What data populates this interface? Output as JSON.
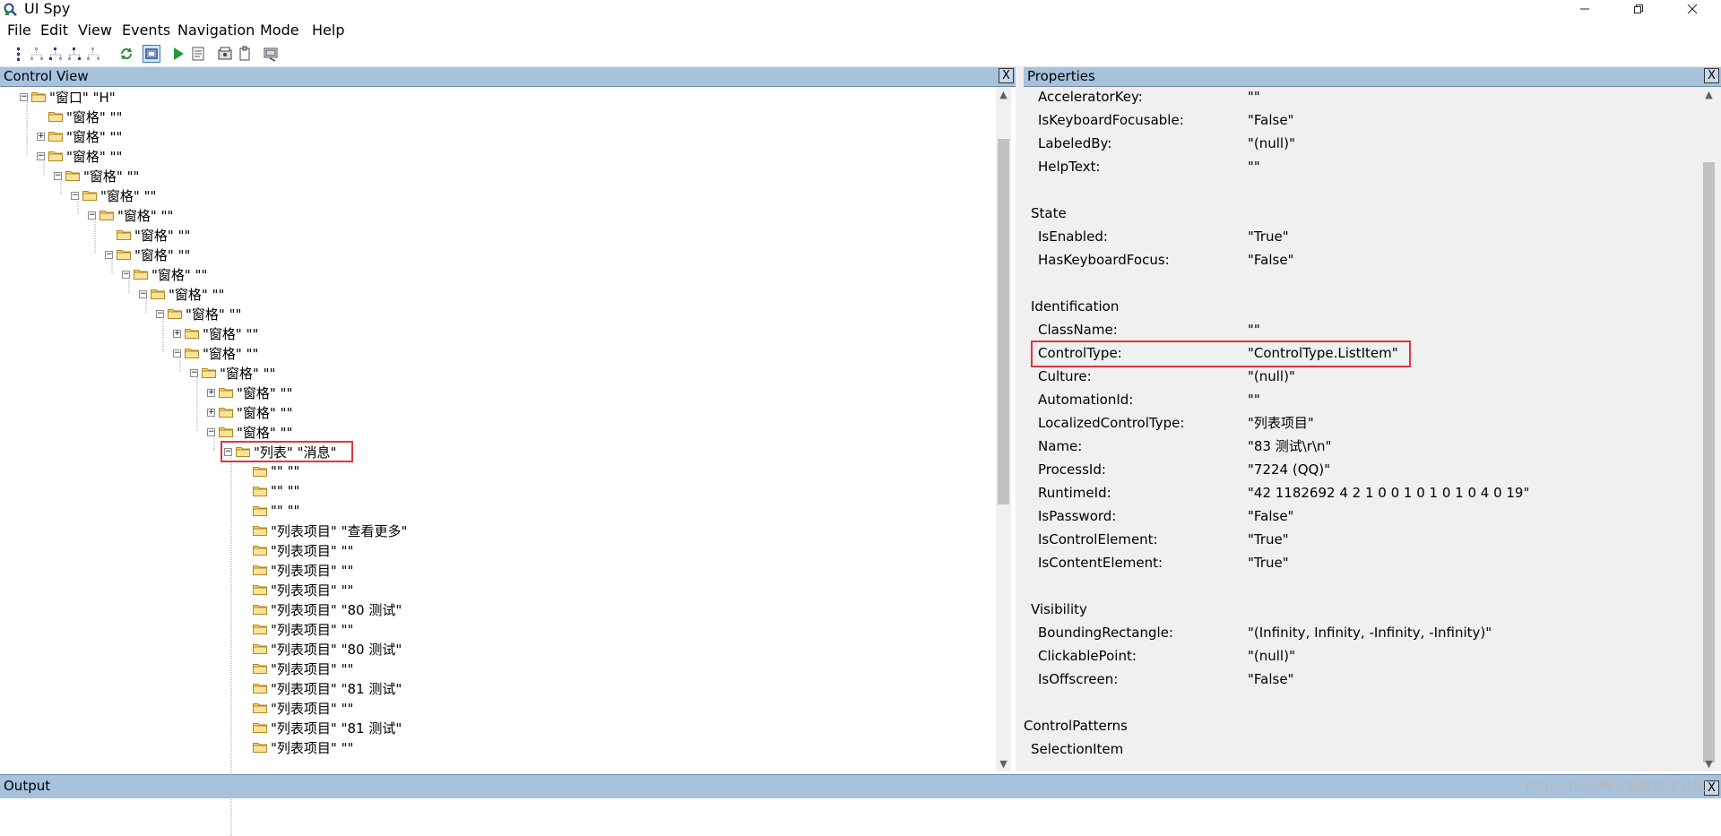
{
  "window": {
    "title": "UI Spy"
  },
  "menu": [
    "File",
    "Edit",
    "View",
    "Events",
    "Navigation",
    "Mode",
    "Help"
  ],
  "toolbar": {
    "icons": [
      "tree-nav-icon",
      "tree-parent-icon",
      "tree-first-child-icon",
      "tree-next-sibling-icon",
      "tree-last-child-icon",
      "refresh-icon",
      "focus-tracking-icon",
      "play-icon",
      "report-icon",
      "record-icon",
      "clipboard-icon",
      "highlight-icon"
    ]
  },
  "control_view": {
    "title": "Control View",
    "close": "X",
    "nodes": [
      {
        "label": "\"窗口\" \"H\"",
        "state": "minus"
      },
      {
        "label": "\"窗格\" \"\"",
        "state": "none"
      },
      {
        "label": "\"窗格\" \"\"",
        "state": "plus"
      },
      {
        "label": "\"窗格\" \"\"",
        "state": "minus"
      },
      {
        "label": "\"窗格\" \"\"",
        "state": "minus"
      },
      {
        "label": "\"窗格\" \"\"",
        "state": "minus"
      },
      {
        "label": "\"窗格\" \"\"",
        "state": "minus"
      },
      {
        "label": "\"窗格\" \"\"",
        "state": "none"
      },
      {
        "label": "\"窗格\" \"\"",
        "state": "minus"
      },
      {
        "label": "\"窗格\" \"\"",
        "state": "minus"
      },
      {
        "label": "\"窗格\" \"\"",
        "state": "minus"
      },
      {
        "label": "\"窗格\" \"\"",
        "state": "minus"
      },
      {
        "label": "\"窗格\" \"\"",
        "state": "plus"
      },
      {
        "label": "\"窗格\" \"\"",
        "state": "minus"
      },
      {
        "label": "\"窗格\" \"\"",
        "state": "minus"
      },
      {
        "label": "\"窗格\" \"\"",
        "state": "plus"
      },
      {
        "label": "\"窗格\" \"\"",
        "state": "plus"
      },
      {
        "label": "\"窗格\" \"\"",
        "state": "minus"
      },
      {
        "label": "\"列表\" \"消息\"",
        "state": "minus",
        "highlight": true
      },
      {
        "label": "\"\" \"\"",
        "state": "none"
      },
      {
        "label": "\"\" \"\"",
        "state": "none"
      },
      {
        "label": "\"\" \"\"",
        "state": "none"
      },
      {
        "label": "\"列表项目\" \"查看更多\"",
        "state": "none"
      },
      {
        "label": "\"列表项目\" \"\"",
        "state": "none"
      },
      {
        "label": "\"列表项目\" \"\"",
        "state": "none"
      },
      {
        "label": "\"列表项目\" \"\"",
        "state": "none"
      },
      {
        "label": "\"列表项目\" \"80 测试\"",
        "state": "none"
      },
      {
        "label": "\"列表项目\" \"\"",
        "state": "none"
      },
      {
        "label": "\"列表项目\" \"80 测试\"",
        "state": "none"
      },
      {
        "label": "\"列表项目\" \"\"",
        "state": "none"
      },
      {
        "label": "\"列表项目\" \"81 测试\"",
        "state": "none"
      },
      {
        "label": "\"列表项目\" \"\"",
        "state": "none"
      },
      {
        "label": "\"列表项目\" \"81 测试\"",
        "state": "none"
      },
      {
        "label": "\"列表项目\" \"\"",
        "state": "none"
      }
    ]
  },
  "properties": {
    "title": "Properties",
    "close": "X",
    "rows": [
      {
        "type": "prop",
        "key": "AcceleratorKey:",
        "value": "\"\""
      },
      {
        "type": "prop",
        "key": "IsKeyboardFocusable:",
        "value": "\"False\""
      },
      {
        "type": "prop",
        "key": "LabeledBy:",
        "value": "\"(null)\""
      },
      {
        "type": "prop",
        "key": "HelpText:",
        "value": "\"\""
      },
      {
        "type": "blank"
      },
      {
        "type": "section",
        "label": "State"
      },
      {
        "type": "prop",
        "key": "IsEnabled:",
        "value": "\"True\""
      },
      {
        "type": "prop",
        "key": "HasKeyboardFocus:",
        "value": "\"False\""
      },
      {
        "type": "blank"
      },
      {
        "type": "section",
        "label": "Identification"
      },
      {
        "type": "prop",
        "key": "ClassName:",
        "value": "\"\""
      },
      {
        "type": "prop",
        "key": "ControlType:",
        "value": "\"ControlType.ListItem\"",
        "highlight": true
      },
      {
        "type": "prop",
        "key": "Culture:",
        "value": "\"(null)\""
      },
      {
        "type": "prop",
        "key": "AutomationId:",
        "value": "\"\""
      },
      {
        "type": "prop",
        "key": "LocalizedControlType:",
        "value": "\"列表项目\""
      },
      {
        "type": "prop",
        "key": "Name:",
        "value": "\"83 测试\\r\\n\""
      },
      {
        "type": "prop",
        "key": "ProcessId:",
        "value": "\"7224 (QQ)\""
      },
      {
        "type": "prop",
        "key": "RuntimeId:",
        "value": "\"42 1182692 4 2 1 0 0 1 0 1 0 1 0 4 0 19\""
      },
      {
        "type": "prop",
        "key": "IsPassword:",
        "value": "\"False\""
      },
      {
        "type": "prop",
        "key": "IsControlElement:",
        "value": "\"True\""
      },
      {
        "type": "prop",
        "key": "IsContentElement:",
        "value": "\"True\""
      },
      {
        "type": "blank"
      },
      {
        "type": "section",
        "label": "Visibility"
      },
      {
        "type": "prop",
        "key": "BoundingRectangle:",
        "value": "\"(Infinity, Infinity, -Infinity, -Infinity)\""
      },
      {
        "type": "prop",
        "key": "ClickablePoint:",
        "value": "\"(null)\""
      },
      {
        "type": "prop",
        "key": "IsOffscreen:",
        "value": "\"False\""
      },
      {
        "type": "blank"
      },
      {
        "type": "top",
        "label": "ControlPatterns"
      },
      {
        "type": "section",
        "label": "SelectionItem"
      }
    ]
  },
  "output": {
    "title": "Output",
    "close": "X"
  },
  "watermark": "https://bl@稀土掘金技术社区"
}
